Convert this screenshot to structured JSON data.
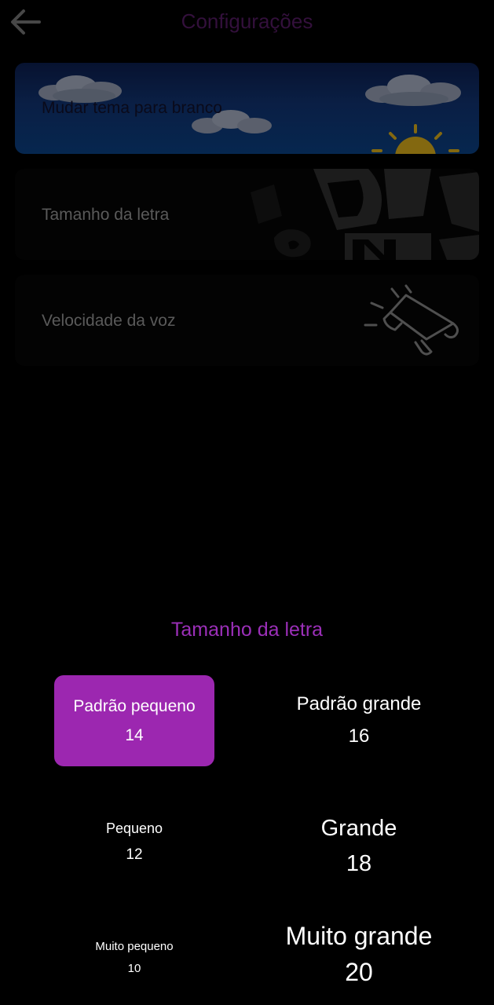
{
  "header": {
    "title": "Configurações"
  },
  "settings": {
    "items": [
      {
        "label": "Mudar tema para branco"
      },
      {
        "label": "Tamanho da letra"
      },
      {
        "label": "Velocidade da voz"
      }
    ]
  },
  "font_sheet": {
    "title": "Tamanho da letra",
    "options": [
      {
        "name": "Padrão pequeno",
        "size": "14",
        "selected": true
      },
      {
        "name": "Padrão grande",
        "size": "16",
        "selected": false
      },
      {
        "name": "Pequeno",
        "size": "12",
        "selected": false
      },
      {
        "name": "Grande",
        "size": "18",
        "selected": false
      },
      {
        "name": "Muito pequeno",
        "size": "10",
        "selected": false
      },
      {
        "name": "Muito grande",
        "size": "20",
        "selected": false
      }
    ]
  },
  "colors": {
    "accent": "#9c27b0",
    "title_accent": "#9b2fb8",
    "background": "#000000"
  },
  "icons": [
    "arrow-left-icon",
    "megaphone-icon",
    "sun-icon",
    "cloud-icon"
  ]
}
